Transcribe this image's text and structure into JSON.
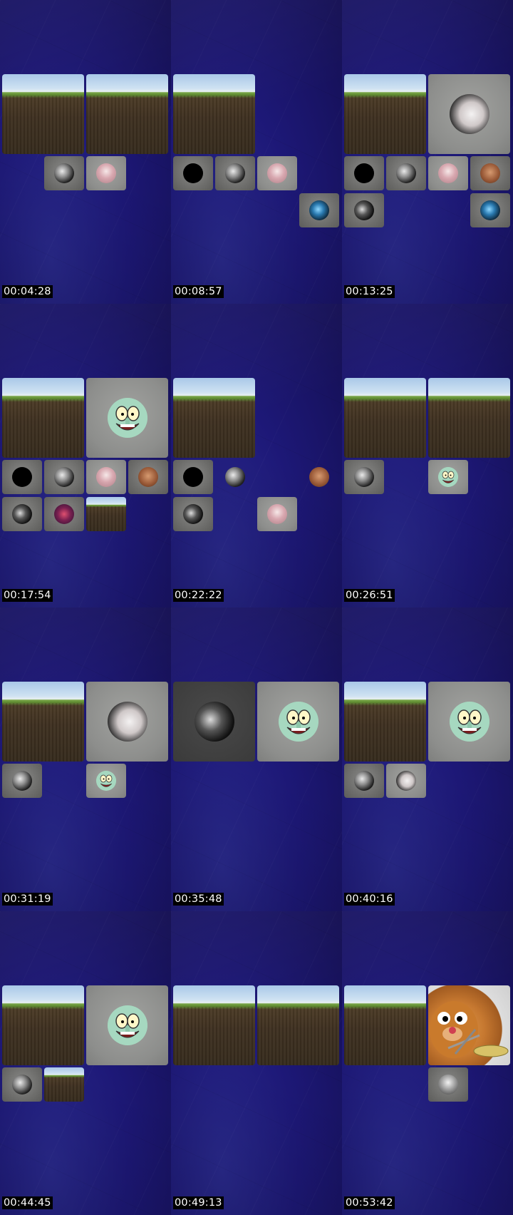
{
  "cells": [
    {
      "timestamp": "00:04:28"
    },
    {
      "timestamp": "00:08:57"
    },
    {
      "timestamp": "00:13:25"
    },
    {
      "timestamp": "00:17:54"
    },
    {
      "timestamp": "00:22:22"
    },
    {
      "timestamp": "00:26:51"
    },
    {
      "timestamp": "00:31:19"
    },
    {
      "timestamp": "00:35:48"
    },
    {
      "timestamp": "00:40:16"
    },
    {
      "timestamp": "00:44:45"
    },
    {
      "timestamp": "00:49:13"
    },
    {
      "timestamp": "00:53:42"
    }
  ],
  "colors": {
    "background": "#17125a",
    "timestamp_bg": "#000000",
    "timestamp_fg": "#ffffff"
  }
}
